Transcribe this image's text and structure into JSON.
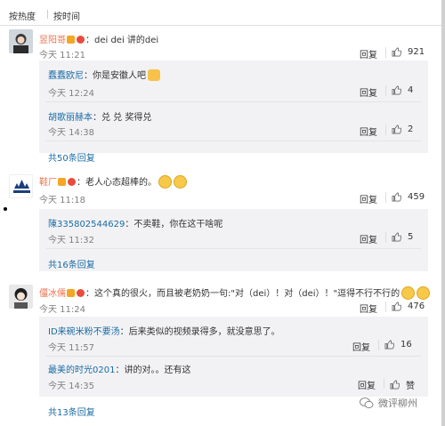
{
  "sort": {
    "hot": "按热度",
    "time": "按时间"
  },
  "actions": {
    "reply": "回复"
  },
  "comments": [
    {
      "user": "昱阳哥",
      "text": "：dei dei 讲的dei",
      "time": "今天 11:21",
      "likes": "921",
      "replies": [
        {
          "user": "蠢蠢欧尼",
          "text": "：你是安徽人吧",
          "time": "今天 12:24",
          "likes": "4"
        },
        {
          "user": "胡歌丽赫本",
          "text": "：兑 兑 奖得兑",
          "time": "今天 14:38",
          "likes": "2"
        }
      ],
      "more": "共50条回复"
    },
    {
      "user": "鞋厂",
      "text": "：老人心态超棒的。",
      "time": "今天 11:18",
      "likes": "459",
      "replies": [
        {
          "user": "陳335802544629",
          "text": "：不卖鞋，你在这干啥呢",
          "time": "今天 11:32",
          "likes": "5"
        }
      ],
      "more": "共16条回复"
    },
    {
      "user": "僵冰儒",
      "text": "：这个真的很火，而且被老奶奶一句:\"对（dei）！对（dei）！\"逗得不行不行的",
      "time": "今天 11:24",
      "likes": "476",
      "replies": [
        {
          "user": "ID来碗米粉不要汤",
          "text": "：后来类似的视频录得多，就没意思了。",
          "time": "今天 11:57",
          "likes": "16"
        },
        {
          "user": "最美的时光0201",
          "text": "：讲的对。。还有这",
          "time": "今天 14:35",
          "likes": "赞"
        }
      ],
      "more": "共13条回复"
    }
  ],
  "watermark": "微评柳州"
}
